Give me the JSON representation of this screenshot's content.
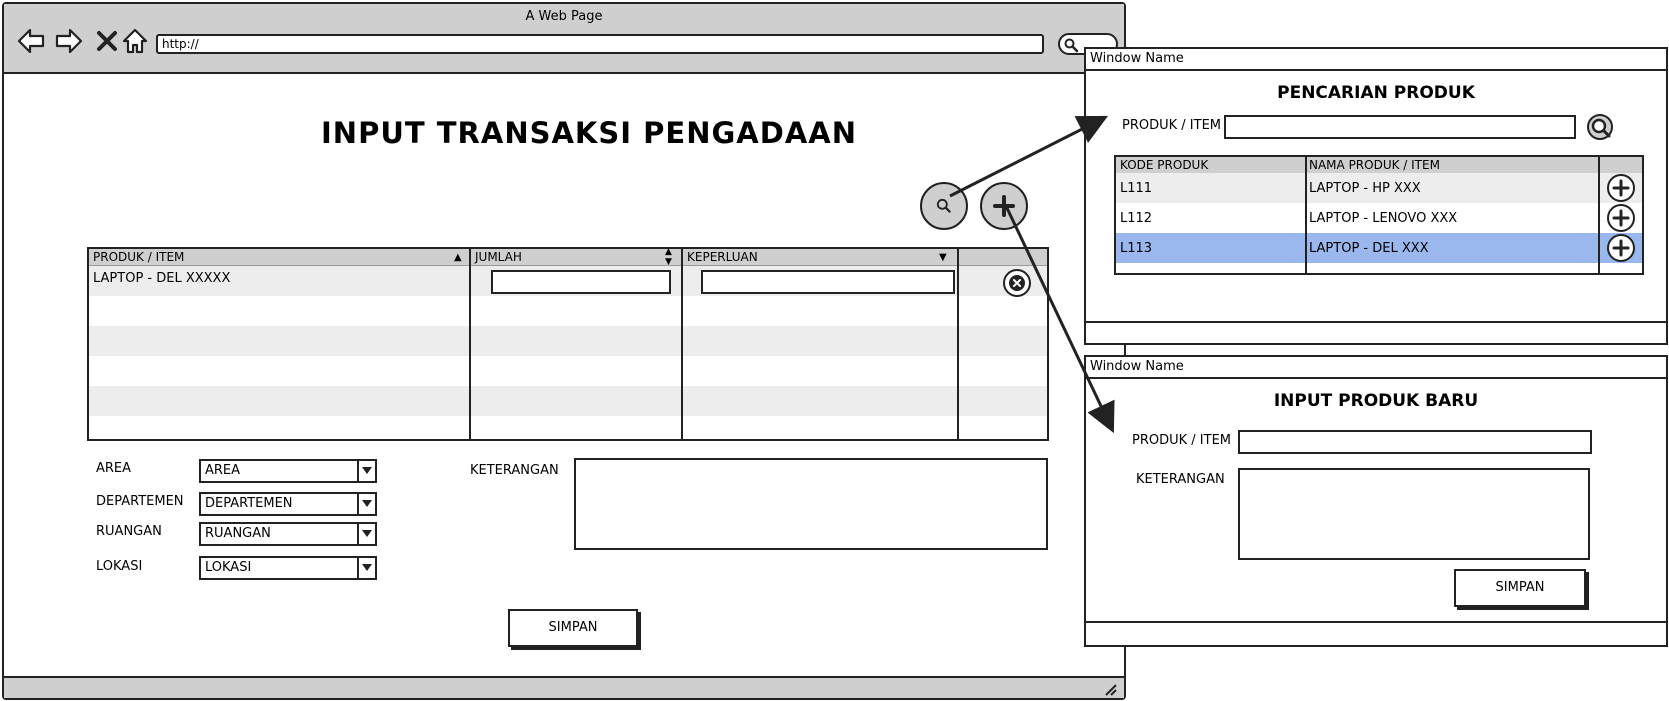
{
  "browser": {
    "title": "A Web Page",
    "url": "http://",
    "icons": [
      "back-arrow-icon",
      "forward-arrow-icon",
      "close-x-icon",
      "home-icon",
      "search-icon"
    ]
  },
  "main": {
    "title": "INPUT TRANSAKSI PENGADAAN",
    "table": {
      "columns": [
        "PRODUK / ITEM",
        "JUMLAH",
        "KEPERLUAN",
        ""
      ],
      "rows": [
        {
          "produk": "LAPTOP - DEL XXXXX",
          "jumlah": "",
          "keperluan": ""
        }
      ]
    },
    "fields": {
      "area_label": "AREA",
      "area_value": "AREA",
      "departemen_label": "DEPARTEMEN",
      "departemen_value": "DEPARTEMEN",
      "ruangan_label": "RUANGAN",
      "ruangan_value": "RUANGAN",
      "lokasi_label": "LOKASI",
      "lokasi_value": "LOKASI",
      "keterangan_label": "KETERANGAN"
    },
    "save_label": "SIMPAN"
  },
  "search_window": {
    "window_name": "Window Name",
    "heading": "PENCARIAN PRODUK",
    "search_label": "PRODUK / ITEM",
    "columns": [
      "KODE PRODUK",
      "NAMA PRODUK / ITEM"
    ],
    "rows": [
      {
        "kode": "L111",
        "nama": "LAPTOP - HP XXX",
        "selected": false
      },
      {
        "kode": "L112",
        "nama": "LAPTOP - LENOVO XXX",
        "selected": false
      },
      {
        "kode": "L113",
        "nama": "LAPTOP - DEL XXX",
        "selected": true
      }
    ],
    "selected_color": "#9ab8ee"
  },
  "new_product_window": {
    "window_name": "Window Name",
    "heading": "INPUT PRODUK BARU",
    "produk_label": "PRODUK / ITEM",
    "keterangan_label": "KETERANGAN",
    "save_label": "SIMPAN"
  }
}
